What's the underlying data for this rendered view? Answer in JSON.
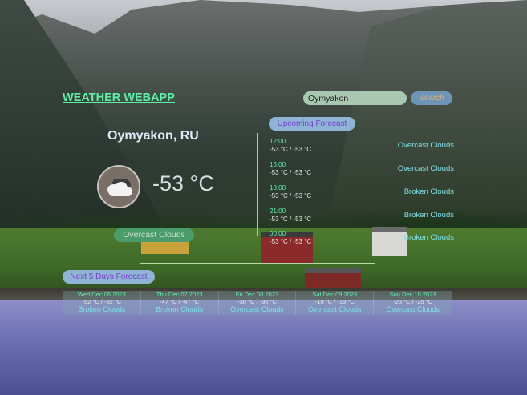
{
  "app": {
    "title": "WEATHER WEBAPP"
  },
  "search": {
    "value": "Oymyakon",
    "button_label": "Search"
  },
  "current": {
    "city": "Oymyakon, RU",
    "temperature": "-53 °C",
    "description": "Overcast Clouds",
    "icon": "cloud-icon"
  },
  "upcoming": {
    "label": "Upcoming Forecast",
    "items": [
      {
        "time": "12:00",
        "temp": "-53 °C / -53 °C",
        "desc": "Overcast Clouds"
      },
      {
        "time": "15:00",
        "temp": "-53 °C / -53 °C",
        "desc": "Overcast Clouds"
      },
      {
        "time": "18:00",
        "temp": "-53 °C / -53 °C",
        "desc": "Broken Clouds"
      },
      {
        "time": "21:00",
        "temp": "-53 °C / -53 °C",
        "desc": "Broken Clouds"
      },
      {
        "time": "00:00",
        "temp": "-53 °C / -53 °C",
        "desc": "Broken Clouds"
      }
    ]
  },
  "next_days": {
    "label": "Next 5 Days Forecast",
    "items": [
      {
        "date": "Wed Dec 06 2023",
        "temp": "-52 °C / -52 °C",
        "desc": "Broken Clouds"
      },
      {
        "date": "Thu Dec 07 2023",
        "temp": "-47 °C / -47 °C",
        "desc": "Broken Clouds"
      },
      {
        "date": "Fri Dec 08 2023",
        "temp": "-30 °C / -30 °C",
        "desc": "Overcast Clouds"
      },
      {
        "date": "Sat Dec 09 2023",
        "temp": "-19 °C / -19 °C",
        "desc": "Overcast Clouds"
      },
      {
        "date": "Sun Dec 10 2023",
        "temp": "-25 °C / -25 °C",
        "desc": "Overcast Clouds"
      }
    ]
  },
  "colors": {
    "accent_green": "#5bf2a6",
    "pill_blue": "#8fb4d6",
    "pill_text": "#7a3fd0",
    "desc_cyan": "#7fe0e6"
  }
}
